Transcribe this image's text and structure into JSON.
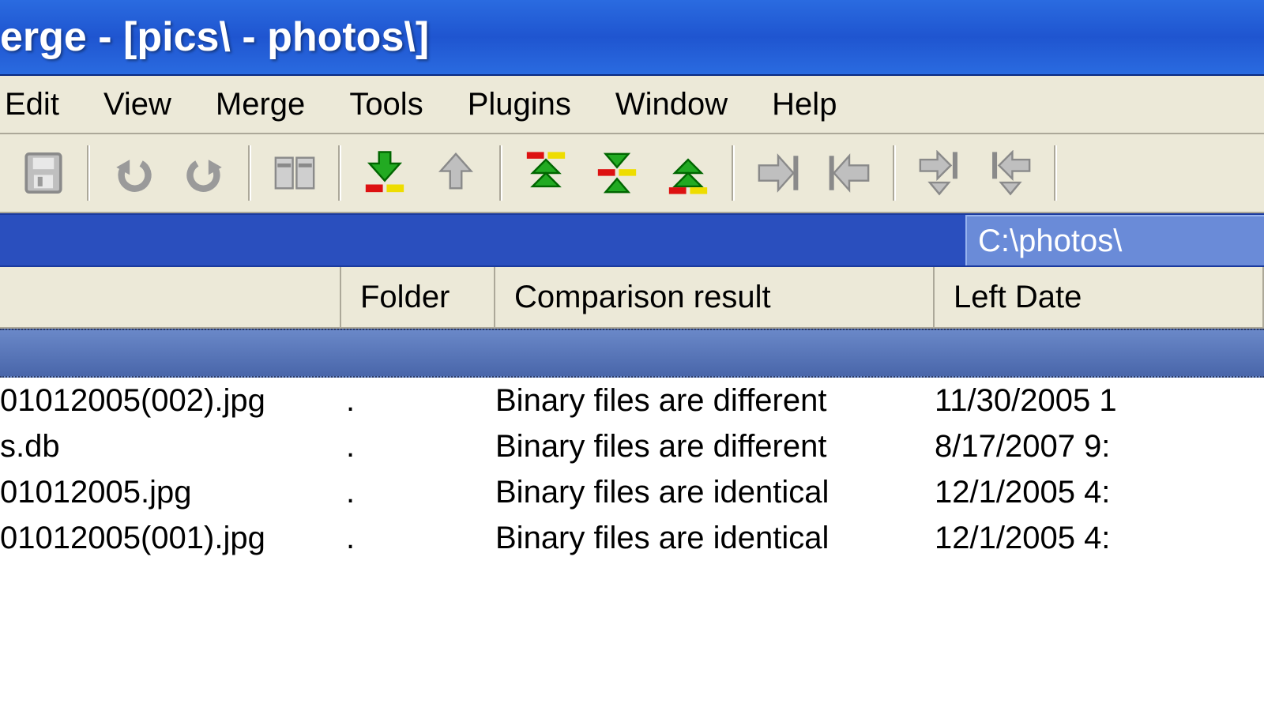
{
  "window": {
    "title": "erge - [pics\\ - photos\\]"
  },
  "menu": {
    "items": [
      "Edit",
      "View",
      "Merge",
      "Tools",
      "Plugins",
      "Window",
      "Help"
    ]
  },
  "path": {
    "right": "C:\\photos\\"
  },
  "columns": {
    "name": "",
    "folder": "Folder",
    "result": "Comparison result",
    "left_date": "Left Date"
  },
  "rows": [
    {
      "name": "01012005(002).jpg",
      "folder": ".",
      "result": "Binary files are different",
      "date": "11/30/2005 1"
    },
    {
      "name": "s.db",
      "folder": ".",
      "result": "Binary files are different",
      "date": "8/17/2007 9:"
    },
    {
      "name": "01012005.jpg",
      "folder": ".",
      "result": "Binary files are identical",
      "date": "12/1/2005 4:"
    },
    {
      "name": "01012005(001).jpg",
      "folder": ".",
      "result": "Binary files are identical",
      "date": "12/1/2005 4:"
    }
  ],
  "toolbar": {
    "save": "save",
    "undo": "undo",
    "redo": "redo",
    "diff_pane": "diff_pane",
    "next_diff": "next_diff",
    "prev_diff": "prev_diff",
    "first_diff": "first_diff",
    "curr_diff": "curr_diff",
    "last_diff": "last_diff",
    "copy_right": "copy_right",
    "copy_left": "copy_left",
    "copy_right_advance": "copy_right_advance",
    "copy_left_advance": "copy_left_advance"
  }
}
